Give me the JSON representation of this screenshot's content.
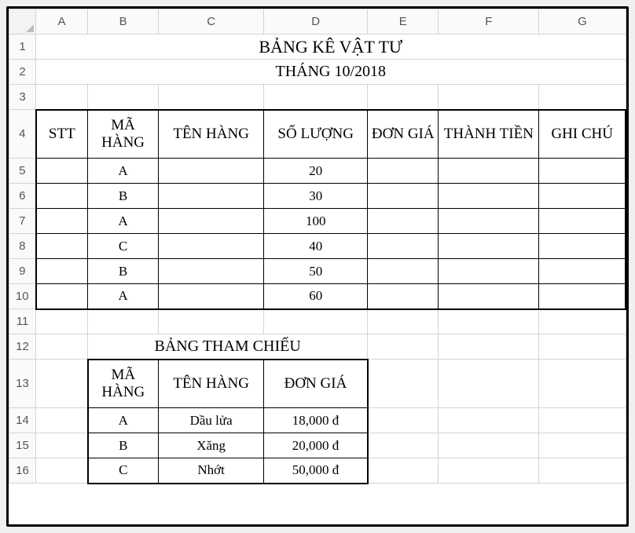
{
  "cols": [
    "A",
    "B",
    "C",
    "D",
    "E",
    "F",
    "G"
  ],
  "title": "BẢNG KÊ VẬT TƯ",
  "subtitle": "THÁNG 10/2018",
  "main": {
    "headers": {
      "stt": "STT",
      "ma": "MÃ HÀNG",
      "ten": "TÊN HÀNG",
      "sl": "SỐ LƯỢNG",
      "dg": "ĐƠN GIÁ",
      "tt": "THÀNH TIỀN",
      "gc": "GHI CHÚ"
    },
    "rows": [
      {
        "ma": "A",
        "sl": "20"
      },
      {
        "ma": "B",
        "sl": "30"
      },
      {
        "ma": "A",
        "sl": "100"
      },
      {
        "ma": "C",
        "sl": "40"
      },
      {
        "ma": "B",
        "sl": "50"
      },
      {
        "ma": "A",
        "sl": "60"
      }
    ]
  },
  "ref": {
    "title": "BẢNG THAM CHIẾU",
    "headers": {
      "ma": "MÃ HÀNG",
      "ten": "TÊN HÀNG",
      "dg": "ĐƠN GIÁ"
    },
    "rows": [
      {
        "ma": "A",
        "ten": "Dầu lửa",
        "dg": "18,000 đ"
      },
      {
        "ma": "B",
        "ten": "Xăng",
        "dg": "20,000 đ"
      },
      {
        "ma": "C",
        "ten": "Nhớt",
        "dg": "50,000 đ"
      }
    ]
  }
}
